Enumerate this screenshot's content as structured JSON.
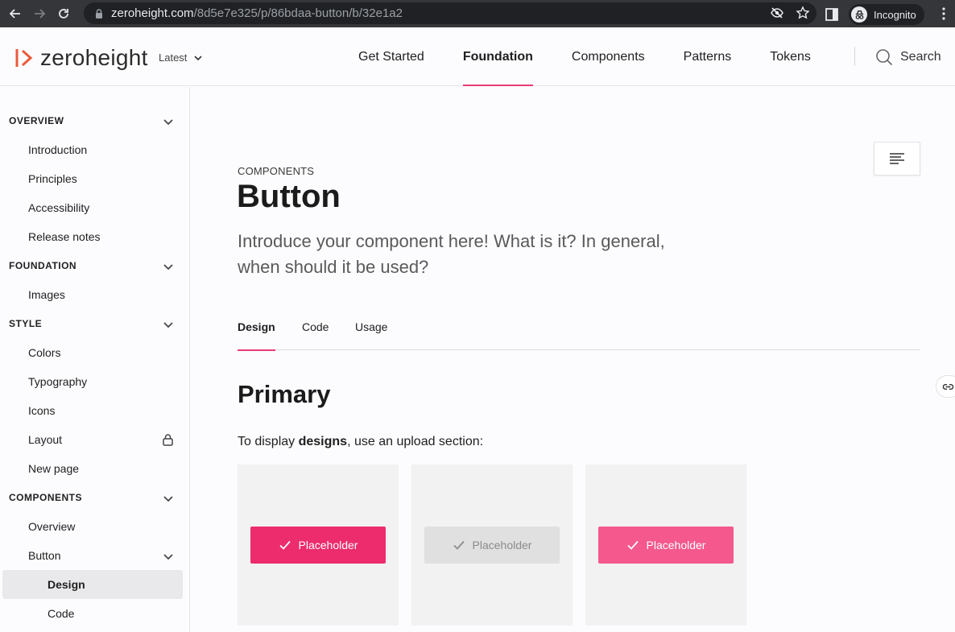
{
  "browser": {
    "url_host": "zeroheight.com",
    "url_path": "/8d5e7e325/p/86bdaa-button/b/32e1a2",
    "profile_label": "Incognito"
  },
  "topnav": {
    "logo_text": "zeroheight",
    "version_label": "Latest",
    "links": [
      {
        "label": "Get Started",
        "active": false
      },
      {
        "label": "Foundation",
        "active": true
      },
      {
        "label": "Components",
        "active": false
      },
      {
        "label": "Patterns",
        "active": false
      },
      {
        "label": "Tokens",
        "active": false
      }
    ],
    "search_label": "Search"
  },
  "sidebar": {
    "sections": [
      {
        "heading": "OVERVIEW",
        "items": [
          "Introduction",
          "Principles",
          "Accessibility",
          "Release notes"
        ]
      },
      {
        "heading": "FOUNDATION",
        "items": [
          "Images"
        ]
      },
      {
        "heading": "STYLE",
        "items": [
          "Colors",
          "Typography",
          "Icons",
          "Layout",
          "New page"
        ]
      },
      {
        "heading": "COMPONENTS",
        "items": [
          "Overview",
          "Button"
        ],
        "subitems": [
          "Design",
          "Code"
        ]
      }
    ],
    "active_item": "Design"
  },
  "main": {
    "eyebrow": "COMPONENTS",
    "title": "Button",
    "intro": "Introduce your component here! What is it? In general, when should it be used?",
    "tabs": [
      {
        "label": "Design",
        "active": true
      },
      {
        "label": "Code",
        "active": false
      },
      {
        "label": "Usage",
        "active": false
      }
    ],
    "section_title": "Primary",
    "para_before": "To display ",
    "para_bold": "designs",
    "para_after": ", use an upload section:",
    "placeholders": [
      {
        "label": "Placeholder",
        "state": "default"
      },
      {
        "label": "Placeholder",
        "state": "disabled"
      },
      {
        "label": "Placeholder",
        "state": "hover"
      }
    ]
  },
  "colors": {
    "accent": "#ea3c75",
    "primary_default": "#ec2c6c",
    "primary_hover": "#f4588d",
    "primary_disabled": "#e0e0e0"
  }
}
